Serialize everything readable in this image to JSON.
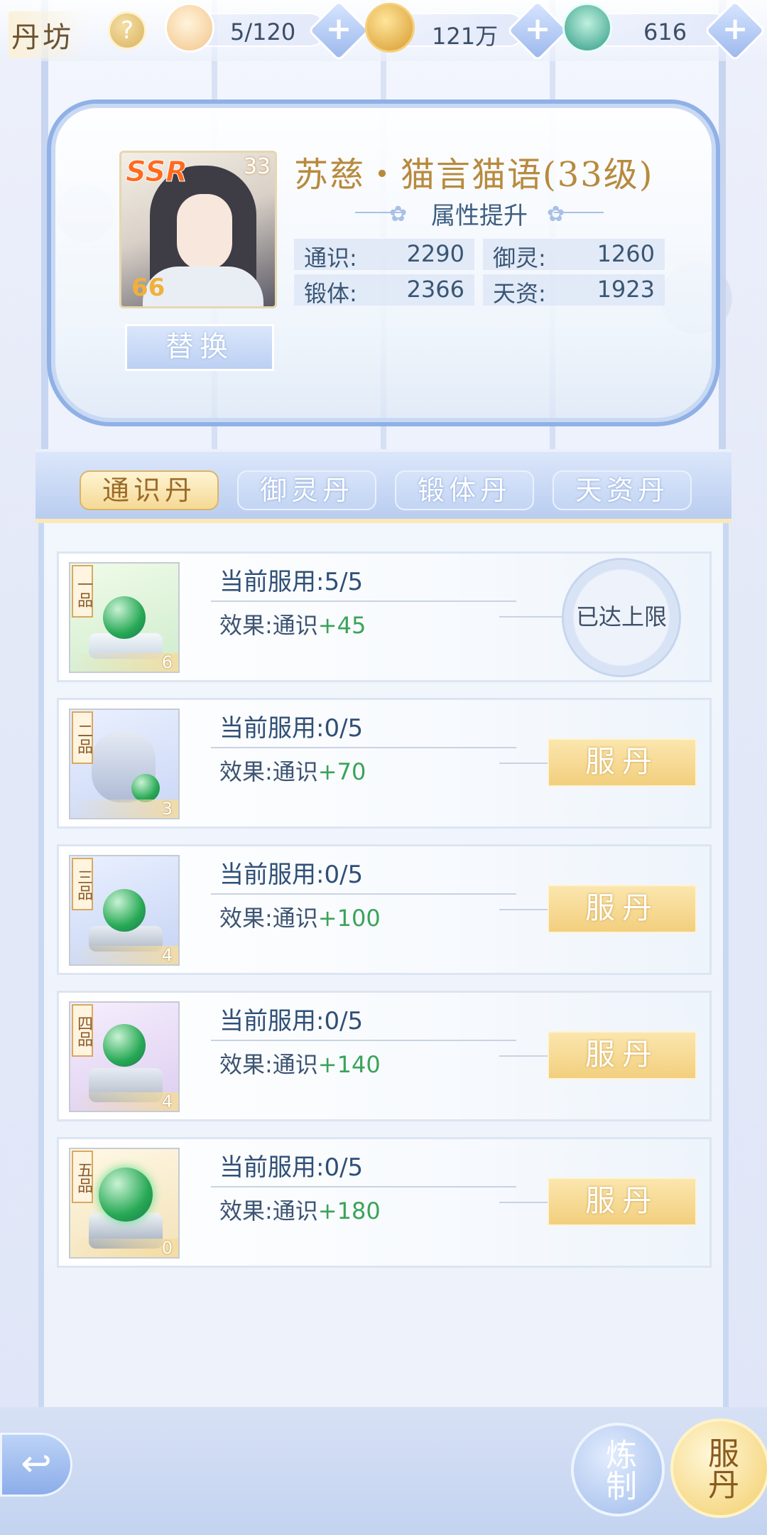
{
  "topbar": {
    "title": "丹坊",
    "help_label": "?",
    "resources": [
      {
        "icon": "cat-face-icon",
        "value": "5/120"
      },
      {
        "icon": "paw-coin-icon",
        "value": "121万"
      },
      {
        "icon": "jade-dragon-icon",
        "value": "616"
      }
    ],
    "plus_label": "+"
  },
  "hero": {
    "ssr_label": "SSR",
    "level": "33",
    "badge": "66",
    "name": "苏慈・猫言猫语(33级)",
    "attr_title": "属性提升",
    "replace_label": "替换",
    "stats": [
      {
        "label": "通识:",
        "value": "2290"
      },
      {
        "label": "御灵:",
        "value": "1260"
      },
      {
        "label": "锻体:",
        "value": "2366"
      },
      {
        "label": "天资:",
        "value": "1923"
      }
    ]
  },
  "tabs": [
    {
      "label": "通识丹",
      "active": true
    },
    {
      "label": "御灵丹",
      "active": false
    },
    {
      "label": "锻体丹",
      "active": false
    },
    {
      "label": "天资丹",
      "active": false
    }
  ],
  "pills": [
    {
      "grade": "一品",
      "count": "6",
      "usage": "当前服用:5/5",
      "effect_label": "效果:通识",
      "effect_value": "+45",
      "action": "已达上限",
      "maxed": true
    },
    {
      "grade": "二品",
      "count": "3",
      "usage": "当前服用:0/5",
      "effect_label": "效果:通识",
      "effect_value": "+70",
      "action": "服丹",
      "maxed": false
    },
    {
      "grade": "三品",
      "count": "4",
      "usage": "当前服用:0/5",
      "effect_label": "效果:通识",
      "effect_value": "+100",
      "action": "服丹",
      "maxed": false
    },
    {
      "grade": "四品",
      "count": "4",
      "usage": "当前服用:0/5",
      "effect_label": "效果:通识",
      "effect_value": "+140",
      "action": "服丹",
      "maxed": false
    },
    {
      "grade": "五品",
      "count": "0",
      "usage": "当前服用:0/5",
      "effect_label": "效果:通识",
      "effect_value": "+180",
      "action": "服丹",
      "maxed": false
    }
  ],
  "bottom": {
    "back_label": "↩",
    "refine_label": "炼制",
    "take_label": "服丹"
  },
  "colors": {
    "accent_gold": "#f2cf7e",
    "accent_blue": "#8fb1e6",
    "effect_green": "#3aa35a"
  }
}
